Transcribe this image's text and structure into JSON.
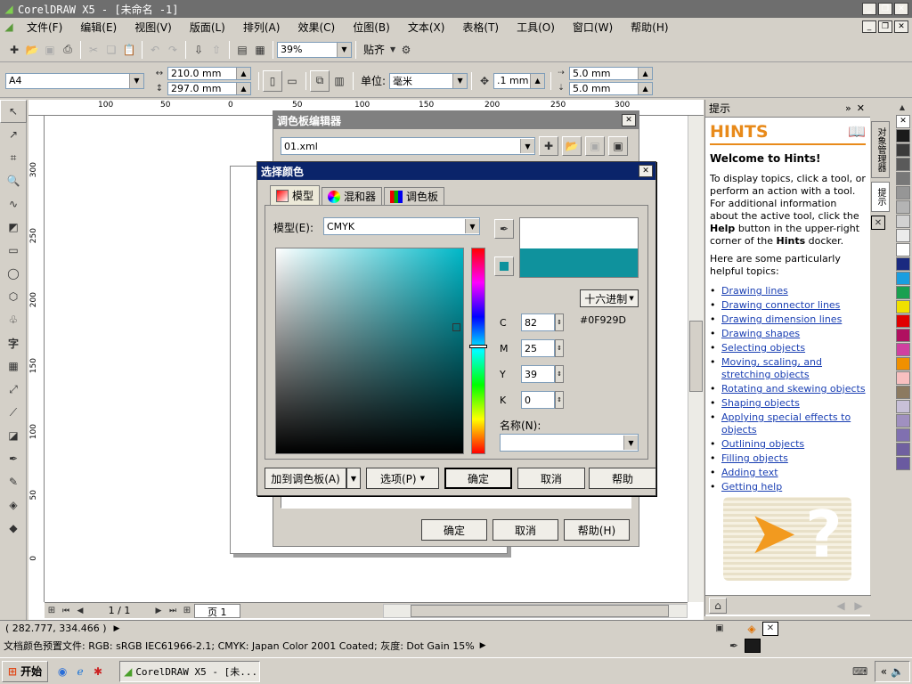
{
  "window": {
    "title": "CorelDRAW X5 - [未命名 -1]"
  },
  "menu": [
    "文件(F)",
    "编辑(E)",
    "视图(V)",
    "版面(L)",
    "排列(A)",
    "效果(C)",
    "位图(B)",
    "文本(X)",
    "表格(T)",
    "工具(O)",
    "窗口(W)",
    "帮助(H)"
  ],
  "toolbar": {
    "zoom": "39%",
    "snap_label": "贴齐"
  },
  "propbar": {
    "page_size": "A4",
    "width": "210.0 mm",
    "height": "297.0 mm",
    "unit_label": "单位:",
    "unit": "毫米",
    "nudge": ".1 mm",
    "dup_x": "5.0 mm",
    "dup_y": "5.0 mm"
  },
  "ruler": {
    "h_ticks": [
      "100",
      "50",
      "0",
      "50",
      "100",
      "150",
      "200",
      "250",
      "300"
    ],
    "v_ticks": [
      "300",
      "250",
      "200",
      "150",
      "100",
      "50",
      "0"
    ]
  },
  "page_nav": {
    "counter": "1 / 1",
    "tab": "页 1"
  },
  "palette_editor": {
    "title": "调色板编辑器",
    "file": "01.xml",
    "ok": "确定",
    "cancel": "取消",
    "help": "帮助(H)"
  },
  "color_dialog": {
    "title": "选择颜色",
    "tabs": [
      "模型",
      "混和器",
      "调色板"
    ],
    "model_label": "模型(E):",
    "model": "CMYK",
    "hex_mode": "十六进制",
    "hex_value": "#0F929D",
    "channels": [
      {
        "label": "C",
        "value": "82"
      },
      {
        "label": "M",
        "value": "25"
      },
      {
        "label": "Y",
        "value": "39"
      },
      {
        "label": "K",
        "value": "0"
      }
    ],
    "name_label": "名称(N):",
    "add_palette": "加到调色板(A)",
    "options": "选项(P)",
    "ok": "确定",
    "cancel": "取消",
    "help": "帮助",
    "new_color": "#0f929d",
    "old_color": "#ffffff"
  },
  "hints": {
    "panel_title": "提示",
    "heading": "HINTS",
    "welcome": "Welcome to Hints!",
    "intro_1": "To display topics, click a tool, or perform an action with a tool. For additional information about the active tool, click the",
    "intro_bold_1": "Help",
    "intro_2": "button in the upper-right corner of the",
    "intro_bold_2": "Hints",
    "intro_3": "docker.",
    "topics_intro": "Here are some particularly helpful topics:",
    "links": [
      "Drawing lines",
      "Drawing connector lines",
      "Drawing dimension lines",
      "Drawing shapes",
      "Selecting objects",
      "Moving, scaling, and stretching objects",
      "Rotating and skewing objects",
      "Shaping objects",
      "Applying special effects to objects",
      "Outlining objects",
      "Filling objects",
      "Adding text",
      "Getting help"
    ],
    "dock_tab_1": "对象管理器",
    "dock_tab_2": "提示"
  },
  "palette_colors": [
    "#1a1a1a",
    "#3b3b3b",
    "#5a5a5a",
    "#787878",
    "#969696",
    "#b4b4b4",
    "#d2d2d2",
    "#ebebeb",
    "#ffffff",
    "#1a2a80",
    "#1a9ee0",
    "#1aa050",
    "#f0e000",
    "#e00000",
    "#b01060",
    "#d040a0",
    "#f09000",
    "#f8c0c0",
    "#8c7a60",
    "#c8c0d8",
    "#a090c0",
    "#8070b0",
    "#7060a0",
    "#6a5aa0"
  ],
  "status": {
    "coords": "( 282.777, 334.466 )",
    "profile": "文档颜色预置文件: RGB: sRGB IEC61966-2.1; CMYK: Japan Color 2001 Coated; 灰度: Dot Gain 15%"
  },
  "taskbar": {
    "start": "开始",
    "task": "CorelDRAW X5 - [未..."
  }
}
